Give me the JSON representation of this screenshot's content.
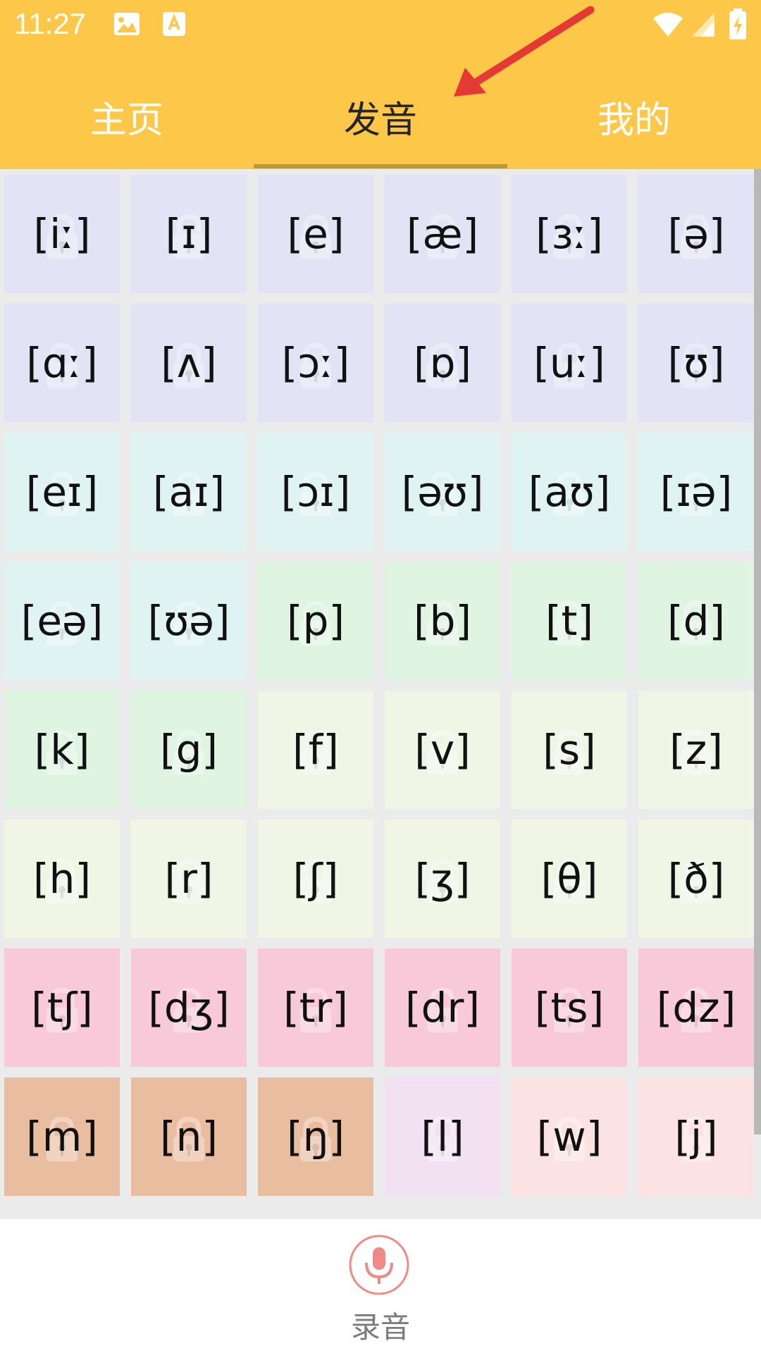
{
  "status_bar": {
    "time": "11:27"
  },
  "tabs": [
    {
      "label": "主页",
      "active": false
    },
    {
      "label": "发音",
      "active": true
    },
    {
      "label": "我的",
      "active": false
    }
  ],
  "colors": {
    "header": "#fdc749",
    "vowels_monophthong": "#e3e3f5",
    "vowels_diphthong": "#dff3f3",
    "consonant_green": "#e0f4e2",
    "consonant_beige": "#f1f5e5",
    "consonant_pink": "#f7c9d9",
    "consonant_orange": "#e8bda0",
    "consonant_lavender": "#f1e1f3",
    "consonant_rose": "#fbe2e3"
  },
  "phonetics": [
    {
      "symbol": "[iː]",
      "color": "#e3e3f5"
    },
    {
      "symbol": "[ɪ]",
      "color": "#e3e3f5"
    },
    {
      "symbol": "[e]",
      "color": "#e3e3f5"
    },
    {
      "symbol": "[æ]",
      "color": "#e3e3f5"
    },
    {
      "symbol": "[ɜː]",
      "color": "#e3e3f5"
    },
    {
      "symbol": "[ə]",
      "color": "#e3e3f5"
    },
    {
      "symbol": "[ɑː]",
      "color": "#e3e3f5"
    },
    {
      "symbol": "[ʌ]",
      "color": "#e3e3f5"
    },
    {
      "symbol": "[ɔː]",
      "color": "#e3e3f5"
    },
    {
      "symbol": "[ɒ]",
      "color": "#e3e3f5"
    },
    {
      "symbol": "[uː]",
      "color": "#e3e3f5"
    },
    {
      "symbol": "[ʊ]",
      "color": "#e3e3f5"
    },
    {
      "symbol": "[eɪ]",
      "color": "#dff3f3"
    },
    {
      "symbol": "[aɪ]",
      "color": "#dff3f3"
    },
    {
      "symbol": "[ɔɪ]",
      "color": "#dff3f3"
    },
    {
      "symbol": "[əʊ]",
      "color": "#dff3f3"
    },
    {
      "symbol": "[aʊ]",
      "color": "#dff3f3"
    },
    {
      "symbol": "[ɪə]",
      "color": "#dff3f3"
    },
    {
      "symbol": "[eə]",
      "color": "#dff3f3"
    },
    {
      "symbol": "[ʊə]",
      "color": "#dff3f3"
    },
    {
      "symbol": "[p]",
      "color": "#e0f4e2"
    },
    {
      "symbol": "[b]",
      "color": "#e0f4e2"
    },
    {
      "symbol": "[t]",
      "color": "#e0f4e2"
    },
    {
      "symbol": "[d]",
      "color": "#e0f4e2"
    },
    {
      "symbol": "[k]",
      "color": "#e0f4e2"
    },
    {
      "symbol": "[g]",
      "color": "#e0f4e2"
    },
    {
      "symbol": "[f]",
      "color": "#f1f5e5"
    },
    {
      "symbol": "[v]",
      "color": "#f1f5e5"
    },
    {
      "symbol": "[s]",
      "color": "#f1f5e5"
    },
    {
      "symbol": "[z]",
      "color": "#f1f5e5"
    },
    {
      "symbol": "[h]",
      "color": "#f1f5e5"
    },
    {
      "symbol": "[r]",
      "color": "#f1f5e5"
    },
    {
      "symbol": "[ʃ]",
      "color": "#f1f5e5"
    },
    {
      "symbol": "[ʒ]",
      "color": "#f1f5e5"
    },
    {
      "symbol": "[θ]",
      "color": "#f1f5e5"
    },
    {
      "symbol": "[ð]",
      "color": "#f1f5e5"
    },
    {
      "symbol": "[tʃ]",
      "color": "#f7c9d9"
    },
    {
      "symbol": "[dʒ]",
      "color": "#f7c9d9"
    },
    {
      "symbol": "[tr]",
      "color": "#f7c9d9"
    },
    {
      "symbol": "[dr]",
      "color": "#f7c9d9"
    },
    {
      "symbol": "[ts]",
      "color": "#f7c9d9"
    },
    {
      "symbol": "[dz]",
      "color": "#f7c9d9"
    },
    {
      "symbol": "[m]",
      "color": "#e8bda0"
    },
    {
      "symbol": "[n]",
      "color": "#e8bda0"
    },
    {
      "symbol": "[ŋ]",
      "color": "#e8bda0"
    },
    {
      "symbol": "[l]",
      "color": "#f1e1f3"
    },
    {
      "symbol": "[w]",
      "color": "#fbe2e3"
    },
    {
      "symbol": "[j]",
      "color": "#fbe2e3"
    }
  ],
  "record": {
    "label": "录音",
    "icon": "microphone-icon"
  }
}
